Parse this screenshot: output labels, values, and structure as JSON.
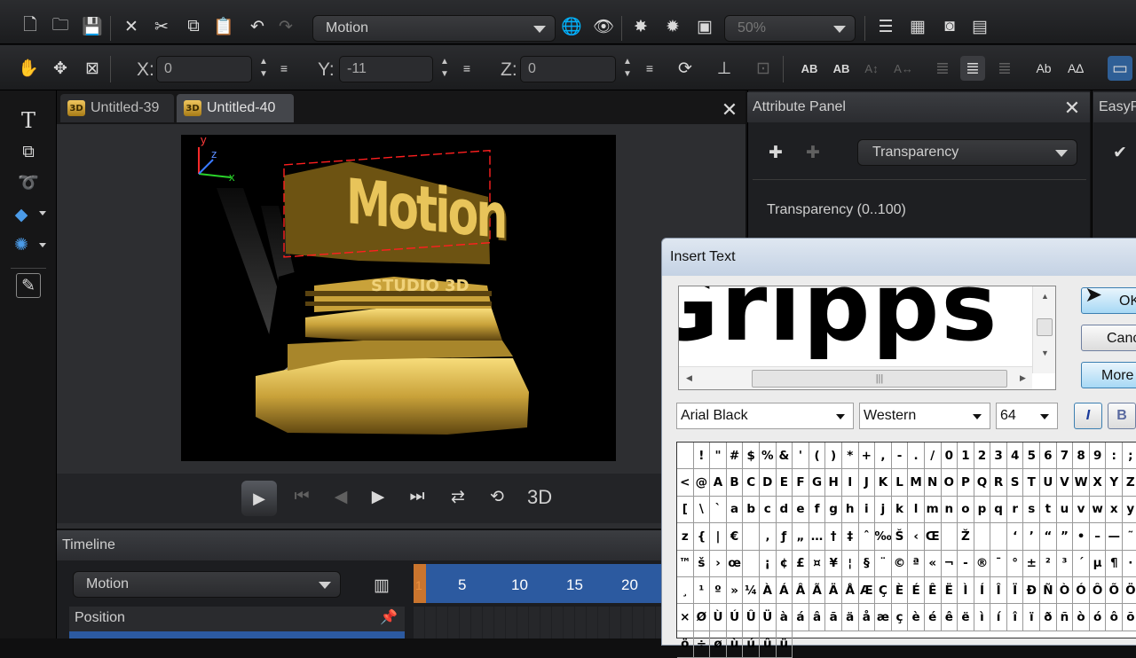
{
  "toolbar1": {
    "object_combo": "Motion",
    "zoom_combo": "50%",
    "icons": [
      "new-icon",
      "open-icon",
      "save-icon",
      "delete-icon",
      "cut-icon",
      "copy-icon",
      "paste-icon",
      "undo-icon",
      "redo-icon",
      "globe-icon",
      "eye-icon",
      "light-icon",
      "light-add-icon",
      "preview-icon",
      "zoom-out-icon",
      "zoom-in-icon",
      "layout-icon",
      "grid-icon",
      "render-icon",
      "export-icon"
    ]
  },
  "toolbar2": {
    "x_label": "X:",
    "x_value": "0",
    "y_label": "Y:",
    "y_value": "-11",
    "z_label": "Z:",
    "z_value": "0",
    "icons": [
      "hand-icon",
      "move-icon",
      "scale-icon",
      "rotate-icon",
      "align-icon",
      "reset-icon",
      "text-spacing-icon",
      "text-kerning-icon",
      "text-width-icon",
      "text-height-icon",
      "align-left-icon",
      "align-center-icon",
      "align-right-icon",
      "text-case-icon",
      "text-size-icon",
      "panel-icon"
    ]
  },
  "tabs": [
    {
      "badge": "3D",
      "label": "Untitled-39"
    },
    {
      "badge": "3D",
      "label": "Untitled-40"
    }
  ],
  "viewport": {
    "axis_x": "x",
    "axis_y": "y",
    "axis_z": "z",
    "scene_title": "Motion",
    "scene_subtitle": "STUDIO 3D"
  },
  "playback": {
    "mode_label": "3D"
  },
  "attribute_panel": {
    "title": "Attribute Panel",
    "combo": "Transparency",
    "property_label": "Transparency (0..100)"
  },
  "easy_panel": {
    "title": "EasyP"
  },
  "timeline": {
    "title": "Timeline",
    "combo": "Motion",
    "ruler": [
      "1",
      "5",
      "10",
      "15",
      "20"
    ],
    "tracks": [
      "Position"
    ]
  },
  "dialog": {
    "title": "Insert Text",
    "preview_text": "Gripps",
    "ok_label": "OK",
    "cancel_label": "Cancel",
    "more_label": "More",
    "font": "Arial Black",
    "script": "Western",
    "size": "64",
    "italic_label": "I",
    "bold_label": "B",
    "charmap": [
      [
        "",
        "!",
        "\"",
        "#",
        "$",
        "%",
        "&",
        "'",
        "(",
        ")",
        "*",
        "+",
        ",",
        "-",
        ".",
        "/",
        "0",
        "1",
        "2",
        "3",
        "4",
        "5",
        "6",
        "7",
        "8",
        "9",
        ":",
        ";",
        "<"
      ],
      [
        "@",
        "A",
        "B",
        "C",
        "D",
        "E",
        "F",
        "G",
        "H",
        "I",
        "J",
        "K",
        "L",
        "M",
        "N",
        "O",
        "P",
        "Q",
        "R",
        "S",
        "T",
        "U",
        "V",
        "W",
        "X",
        "Y",
        "Z",
        "[",
        "\\"
      ],
      [
        "`",
        "a",
        "b",
        "c",
        "d",
        "e",
        "f",
        "g",
        "h",
        "i",
        "j",
        "k",
        "l",
        "m",
        "n",
        "o",
        "p",
        "q",
        "r",
        "s",
        "t",
        "u",
        "v",
        "w",
        "x",
        "y",
        "z",
        "{",
        "|"
      ],
      [
        "€",
        "",
        "‚",
        "ƒ",
        "„",
        "…",
        "†",
        "‡",
        "ˆ",
        "‰",
        "Š",
        "‹",
        "Œ",
        "",
        "Ž",
        "",
        "",
        "‘",
        "’",
        "“",
        "”",
        "•",
        "–",
        "—",
        "˜",
        "™",
        "š",
        "›",
        "œ"
      ],
      [
        "",
        "¡",
        "¢",
        "£",
        "¤",
        "¥",
        "¦",
        "§",
        "¨",
        "©",
        "ª",
        "«",
        "¬",
        "-",
        "®",
        "¯",
        "°",
        "±",
        "²",
        "³",
        "´",
        "µ",
        "¶",
        "·",
        "¸",
        "¹",
        "º",
        "»",
        "¼"
      ],
      [
        "À",
        "Á",
        "Â",
        "Ã",
        "Ä",
        "Å",
        "Æ",
        "Ç",
        "È",
        "É",
        "Ê",
        "Ë",
        "Ì",
        "Í",
        "Î",
        "Ï",
        "Ð",
        "Ñ",
        "Ò",
        "Ó",
        "Ô",
        "Õ",
        "Ö",
        "×",
        "Ø",
        "Ù",
        "Ú",
        "Û",
        "Ü"
      ],
      [
        "à",
        "á",
        "â",
        "ã",
        "ä",
        "å",
        "æ",
        "ç",
        "è",
        "é",
        "ê",
        "ë",
        "ì",
        "í",
        "î",
        "ï",
        "ð",
        "ñ",
        "ò",
        "ó",
        "ô",
        "õ",
        "ö",
        "÷",
        "ø",
        "ù",
        "ú",
        "û",
        "ü"
      ]
    ]
  }
}
